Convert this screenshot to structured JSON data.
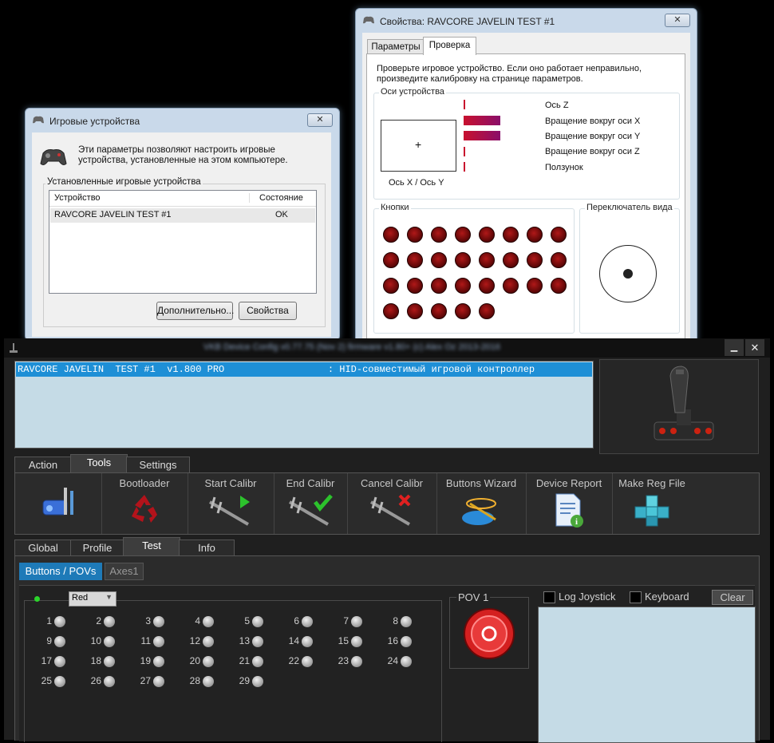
{
  "game_devices": {
    "title": "Игровые устройства",
    "close_label": "✕",
    "description": "Эти параметры позволяют настроить игровые устройства, установленные на этом компьютере.",
    "group_label": "Установленные игровые устройства",
    "columns": [
      "Устройство",
      "Состояние"
    ],
    "rows": [
      {
        "device": "RAVCORE JAVELIN  TEST #1",
        "status": "OK"
      }
    ],
    "advanced_button": "Дополнительно...",
    "properties_button": "Свойства"
  },
  "properties": {
    "title": "Свойства: RAVCORE JAVELIN  TEST #1",
    "close_label": "✕",
    "tabs": [
      "Параметры",
      "Проверка"
    ],
    "active_tab": "Проверка",
    "instruction": "Проверьте игровое устройство. Если оно работает неправильно, произведите калибровку на странице параметров.",
    "axes_group": "Оси устройства",
    "xy_label": "Ось X / Ось Y",
    "axes": [
      {
        "label": "Ось Z",
        "fill": 0
      },
      {
        "label": "Вращение вокруг оси X",
        "fill": 1
      },
      {
        "label": "Вращение вокруг оси Y",
        "fill": 1
      },
      {
        "label": "Вращение вокруг оси Z",
        "fill": 0
      },
      {
        "label": "Ползунок",
        "fill": 0
      }
    ],
    "buttons_group": "Кнопки",
    "button_count": 29,
    "pov_group": "Переключатель вида"
  },
  "app": {
    "title": "VKB Device Config v0.77.75 (Nov 2) firmware v1.80+ (c) Alex Oz 2013-2016",
    "minimize_label": "▁",
    "close_label": "✕",
    "device_line": "RAVCORE JAVELIN  TEST #1  v1.800 PRO                  : HID-совместимый игровой контроллер",
    "main_tabs": [
      "Action",
      "Tools",
      "Settings"
    ],
    "active_main_tab": "Tools",
    "tools": [
      "Bootloader",
      "Start Calibr",
      "End Calibr",
      "Cancel Calibr",
      "Buttons Wizard",
      "Device Report",
      "Make Reg File"
    ],
    "sub_tabs": [
      "Global",
      "Profile",
      "Test",
      "Info"
    ],
    "active_sub_tab": "Test",
    "test_tabs": [
      "Buttons / POVs",
      "Axes1"
    ],
    "color_select": "Red",
    "buttons": [
      "1",
      "2",
      "3",
      "4",
      "5",
      "6",
      "7",
      "8",
      "9",
      "10",
      "11",
      "12",
      "13",
      "14",
      "15",
      "16",
      "17",
      "18",
      "19",
      "20",
      "21",
      "22",
      "23",
      "24",
      "25",
      "26",
      "27",
      "28",
      "29"
    ],
    "pov_label": "POV 1",
    "log_joystick": "Log Joystick",
    "keyboard": "Keyboard",
    "clear": "Clear"
  },
  "colors": {
    "accent_blue": "#1e8fd6",
    "highlight_red": "#c8102e",
    "list_bg": "#c5dbe6"
  }
}
